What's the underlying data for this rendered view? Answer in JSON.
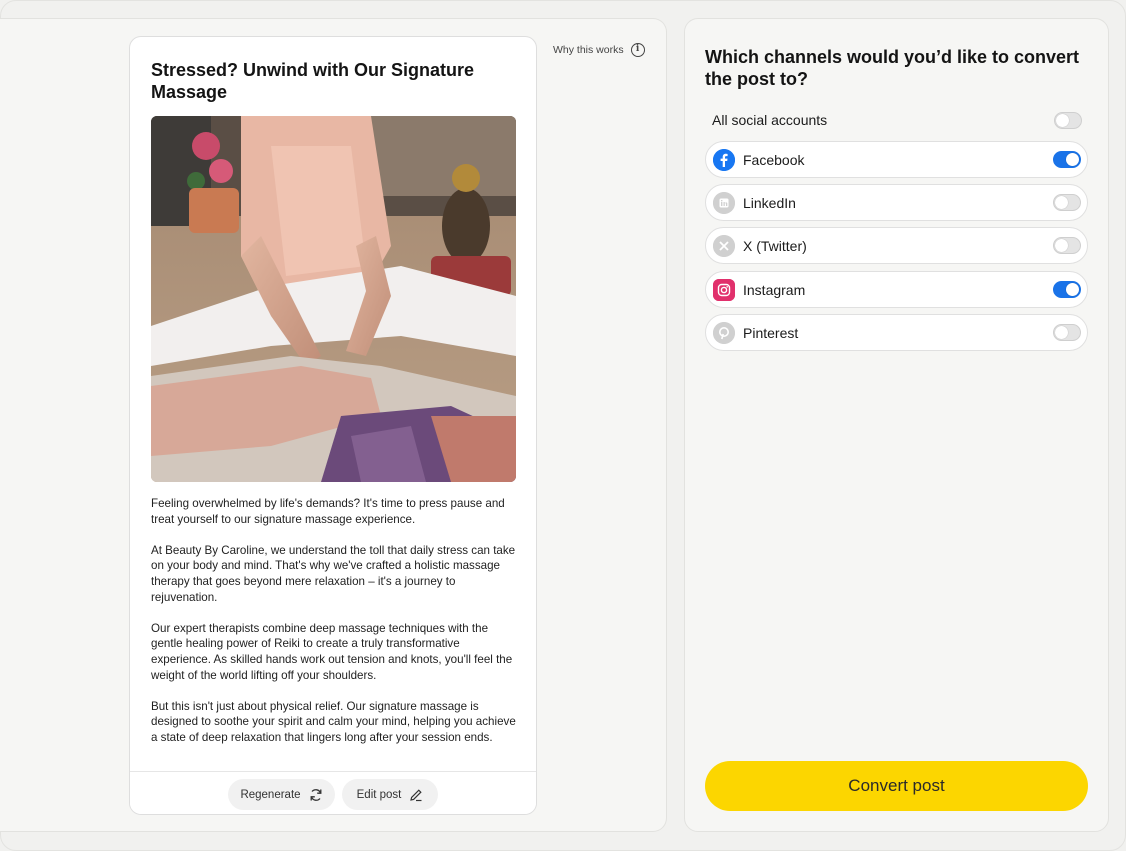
{
  "post": {
    "title": "Stressed? Unwind with Our Signature Massage",
    "paragraphs": [
      "Feeling overwhelmed by life's demands? It's time to press pause and treat yourself to our signature massage experience.",
      "At Beauty By Caroline, we understand the toll that daily stress can take on your body and mind. That's why we've crafted a holistic massage therapy that goes beyond mere relaxation – it's a journey to rejuvenation.",
      "Our expert therapists combine deep massage techniques with the gentle healing power of Reiki to create a truly transformative experience. As skilled hands work out tension and knots, you'll feel the weight of the world lifting off your shoulders.",
      "But this isn't just about physical relief. Our signature massage is designed to soothe your spirit and calm your mind, helping you achieve a state of deep relaxation that lingers long after your session ends."
    ],
    "regenerate_label": "Regenerate",
    "edit_label": "Edit post"
  },
  "why_label": "Why this works",
  "channels_panel": {
    "question": "Which channels would you’d like to convert the post to?",
    "all_label": "All social accounts",
    "all_on": false,
    "channels": [
      {
        "name": "Facebook",
        "icon": "facebook-icon",
        "color": "#1877f2",
        "on": true
      },
      {
        "name": "LinkedIn",
        "icon": "linkedin-icon",
        "color": "#cfcfcf",
        "on": false
      },
      {
        "name": "X (Twitter)",
        "icon": "x-twitter-icon",
        "color": "#cfcfcf",
        "on": false
      },
      {
        "name": "Instagram",
        "icon": "instagram-icon",
        "color": "#e1306c",
        "on": true
      },
      {
        "name": "Pinterest",
        "icon": "pinterest-icon",
        "color": "#cfcfcf",
        "on": false
      }
    ],
    "convert_label": "Convert post"
  },
  "colors": {
    "accent_yellow": "#fcd600",
    "toggle_on": "#1a73e8"
  }
}
